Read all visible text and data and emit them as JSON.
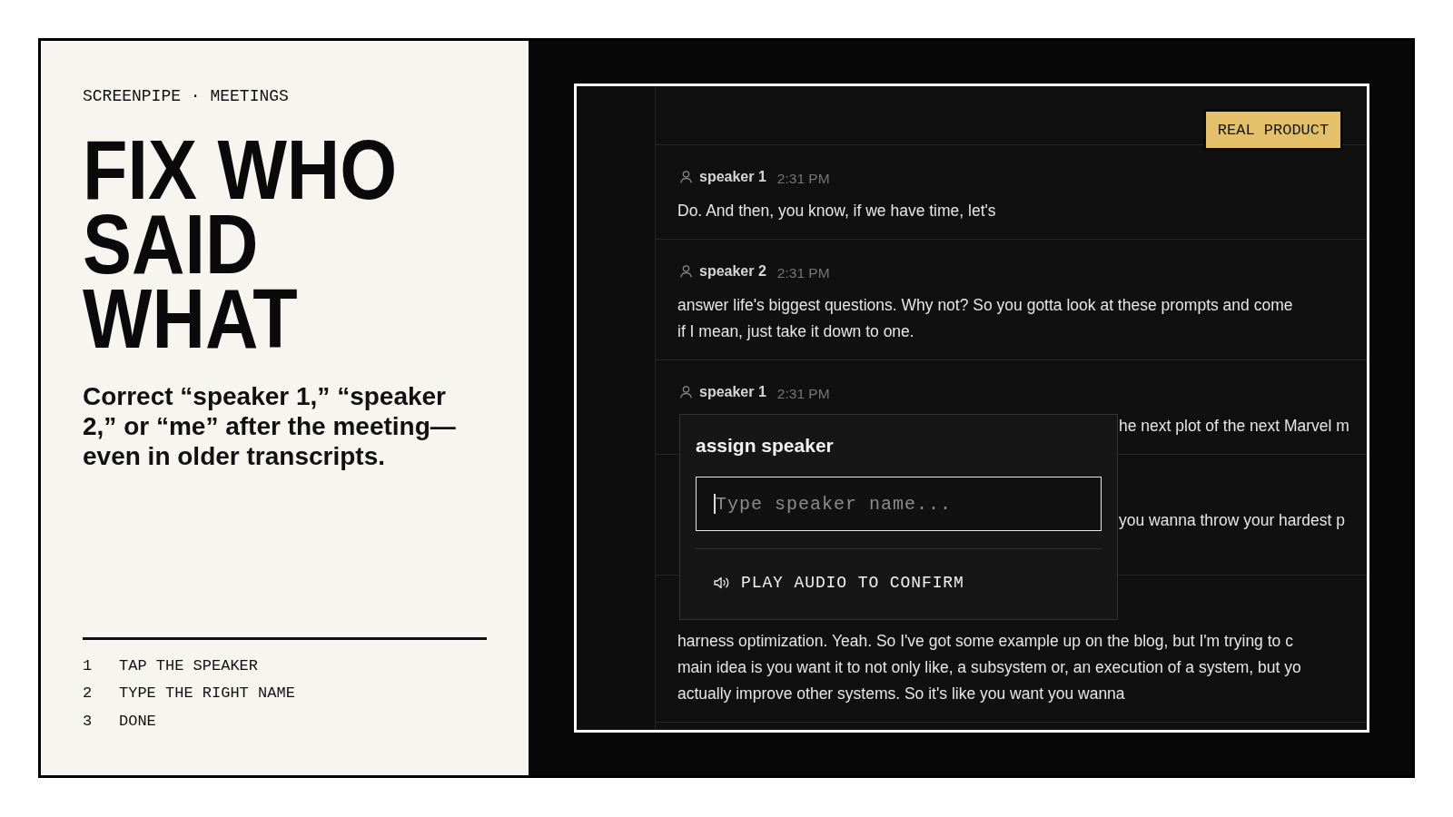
{
  "intro": {
    "eyebrow": "SCREENPIPE · MEETINGS",
    "title_lines": [
      "FIX WHO",
      "SAID",
      "WHAT"
    ],
    "subtitle": "Correct “speaker 1,” “speaker 2,” or “me” after the meeting—even in older transcripts.",
    "steps": [
      {
        "number": "1",
        "label": "TAP THE SPEAKER"
      },
      {
        "number": "2",
        "label": "TYPE THE RIGHT NAME"
      },
      {
        "number": "3",
        "label": "DONE"
      }
    ]
  },
  "screenshot": {
    "badge": "REAL PRODUCT",
    "transcript": [
      {
        "kind": "full",
        "speaker": {
          "name": "speaker 1",
          "time": "2:31 PM"
        },
        "lines": [
          "Do. And then, you know, if we have time, let's"
        ]
      },
      {
        "kind": "full",
        "speaker": {
          "name": "speaker 2",
          "time": "2:31 PM"
        },
        "lines": [
          "answer life's biggest questions. Why not? So you gotta look at these prompts and come",
          "if I mean, just take it down to one."
        ]
      },
      {
        "kind": "partly_covered",
        "speaker": {
          "name": "speaker 1",
          "time": "2:31 PM"
        },
        "lines": [
          "he next plot of the next Marvel m"
        ]
      },
      {
        "kind": "mostly_covered",
        "lines": [
          "you wanna throw your hardest p"
        ]
      },
      {
        "kind": "full",
        "lines": [
          "harness optimization. Yeah. So I've got some example up on the blog, but I'm trying to c",
          "main idea is you want it to not only like, a subsystem or, an execution of a system, but yo",
          "actually improve other systems. So it's like you want you wanna"
        ]
      }
    ],
    "popup": {
      "title": "assign speaker",
      "field": {
        "placeholder": "Type speaker name...",
        "focused": true
      },
      "action": "PLAY AUDIO TO CONFIRM"
    }
  }
}
